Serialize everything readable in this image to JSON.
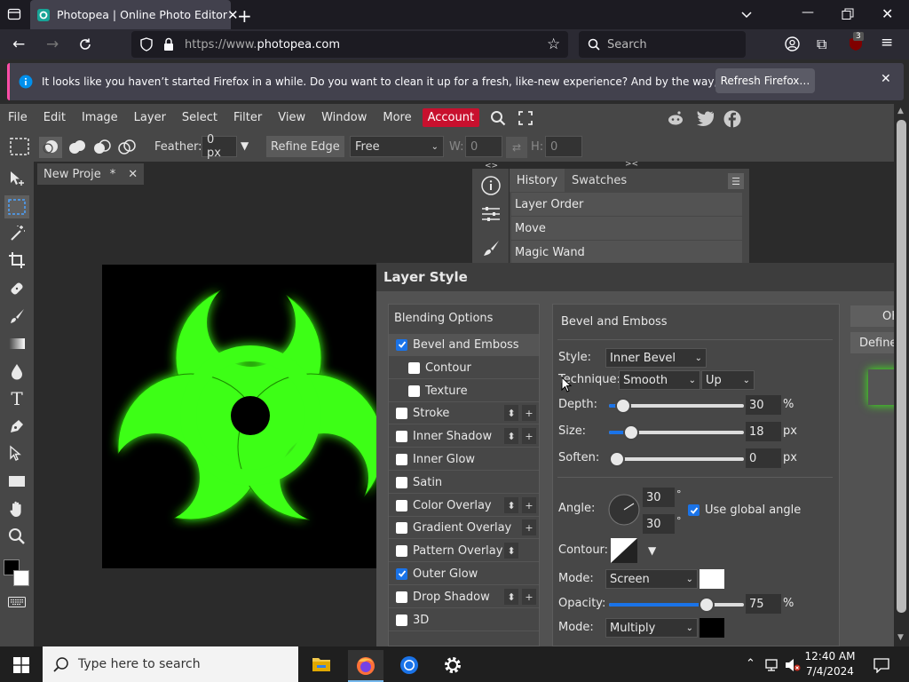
{
  "browser": {
    "tab_title": "Photopea | Online Photo Editor",
    "url_prefix": "https://www.",
    "url_domain": "photopea.com",
    "search_placeholder": "Search",
    "extension_badge": "3",
    "notification": "It looks like you haven’t started Firefox in a while. Do you want to clean it up for a fresh, like-new experience? And by the way, welcome back!",
    "refresh_label": "Refresh Firefox…"
  },
  "menu": {
    "items": [
      "File",
      "Edit",
      "Image",
      "Layer",
      "Select",
      "Filter",
      "View",
      "Window",
      "More"
    ],
    "account": "Account"
  },
  "options": {
    "feather_label": "Feather:",
    "feather_value": "0 px",
    "refine_edge": "Refine Edge",
    "style_value": "Free",
    "w_label": "W:",
    "w_value": "0",
    "h_label": "H:",
    "h_value": "0"
  },
  "document": {
    "tab_label": "New Proje",
    "modified": "*"
  },
  "panels": {
    "history_tab": "History",
    "swatches_tab": "Swatches",
    "history_items": [
      "Layer Order",
      "Move",
      "Magic Wand"
    ]
  },
  "dialog": {
    "title": "Layer Style",
    "blending_options": "Blending Options",
    "effects": [
      {
        "label": "Bevel and Emboss",
        "checked": true,
        "indent": false,
        "buttons": ""
      },
      {
        "label": "Contour",
        "checked": false,
        "indent": true,
        "buttons": ""
      },
      {
        "label": "Texture",
        "checked": false,
        "indent": true,
        "buttons": ""
      },
      {
        "label": "Stroke",
        "checked": false,
        "indent": false,
        "buttons": "both"
      },
      {
        "label": "Inner Shadow",
        "checked": false,
        "indent": false,
        "buttons": "both"
      },
      {
        "label": "Inner Glow",
        "checked": false,
        "indent": false,
        "buttons": ""
      },
      {
        "label": "Satin",
        "checked": false,
        "indent": false,
        "buttons": ""
      },
      {
        "label": "Color Overlay",
        "checked": false,
        "indent": false,
        "buttons": "both"
      },
      {
        "label": "Gradient Overlay",
        "checked": false,
        "indent": false,
        "buttons": "plus"
      },
      {
        "label": "Pattern Overlay",
        "checked": false,
        "indent": false,
        "buttons": "arrow"
      },
      {
        "label": "Outer Glow",
        "checked": true,
        "indent": false,
        "buttons": ""
      },
      {
        "label": "Drop Shadow",
        "checked": false,
        "indent": false,
        "buttons": "both"
      },
      {
        "label": "3D",
        "checked": false,
        "indent": false,
        "buttons": ""
      }
    ],
    "section_title": "Bevel and Emboss",
    "style_label": "Style:",
    "style_value": "Inner Bevel",
    "technique_label": "Technique:",
    "technique_value": "Smooth",
    "direction_value": "Up",
    "depth_label": "Depth:",
    "depth_value": "30",
    "depth_unit": "%",
    "depth_fraction": 0.05,
    "size_label": "Size:",
    "size_value": "18",
    "size_unit": "px",
    "size_fraction": 0.12,
    "soften_label": "Soften:",
    "soften_value": "0",
    "soften_unit": "px",
    "soften_fraction": 0.0,
    "angle_label": "Angle:",
    "angle_value": "30",
    "altitude_value": "30",
    "degree_symbol": "°",
    "global_angle_label": "Use global angle",
    "contour_label": "Contour:",
    "mode_label": "Mode:",
    "highlight_mode": "Screen",
    "opacity_label": "Opacity:",
    "opacity_value": "75",
    "opacity_unit": "%",
    "opacity_fraction": 0.75,
    "shadow_mode": "Multiply",
    "ok_label": "OK",
    "define_label": "Define"
  },
  "taskbar": {
    "search_placeholder": "Type here to search",
    "time": "12:40 AM",
    "date": "7/4/2024"
  },
  "colors": {
    "accent": "#1a73e8",
    "account_red": "#c8102e",
    "glow_green": "#3cff14"
  }
}
